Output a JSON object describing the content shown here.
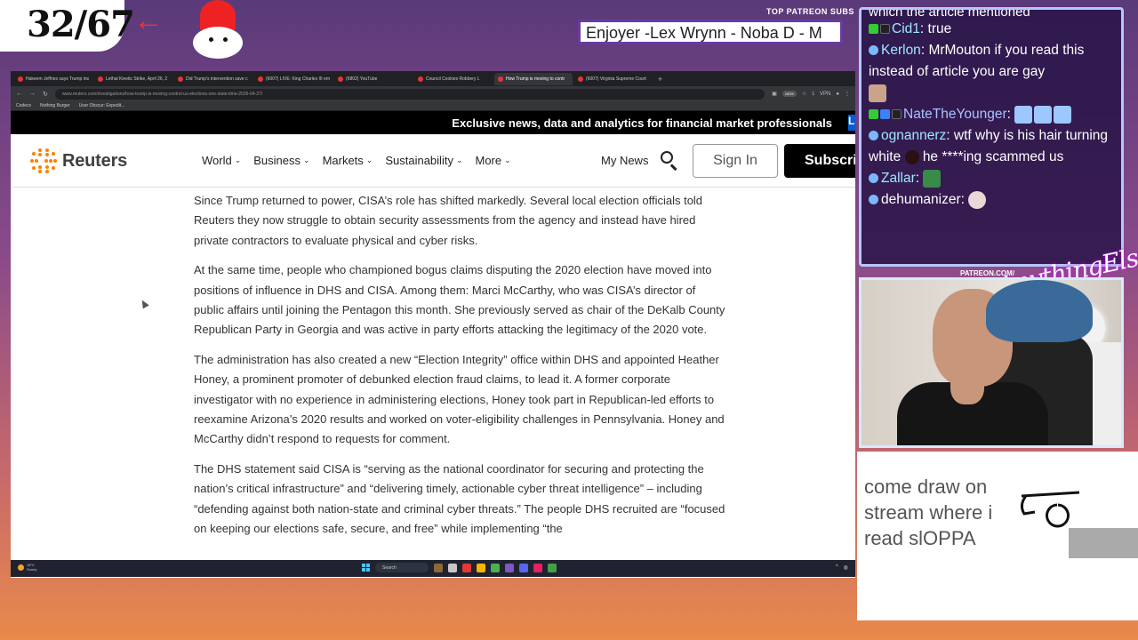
{
  "overlay": {
    "counter": "32/67",
    "patreon_label": "TOP PATREON SUBS",
    "ticker": "Enjoyer -Lex Wrynn -  Noba D - M",
    "patreon_small": "PATREON.COM/",
    "signature": "AnythingElse",
    "draw_text": "come draw on stream where i read slOPPA"
  },
  "browser": {
    "tabs": [
      {
        "label": "Hakeem Jeffries says Trump ins",
        "active": false
      },
      {
        "label": "Lethal Kinetic Strike, April 26, 2",
        "active": false
      },
      {
        "label": "Did Trump's intervention save c",
        "active": false
      },
      {
        "label": "(6007) LIVE: King Charles III em",
        "active": false
      },
      {
        "label": "(6802) YouTube",
        "active": false
      },
      {
        "label": "Council Cookies Robbery L",
        "active": false
      },
      {
        "label": "How Trump is moving to contr",
        "active": true
      },
      {
        "label": "(6007) Virginia Supreme Court",
        "active": false
      }
    ],
    "url": "www.reuters.com/investigations/how-trump-is-moving-control-us-elections-one-state-time-2026-04-27/",
    "zoom": "260%",
    "bookmarks": [
      "Codecs",
      "Nothing Burger",
      "User Obscur: Expedit..."
    ]
  },
  "reuters": {
    "promo": "Exclusive news, data and analytics for financial market professionals",
    "promo_button": "L",
    "logo": "Reuters",
    "nav": [
      "World",
      "Business",
      "Markets",
      "Sustainability",
      "More"
    ],
    "my_news": "My News",
    "sign_in": "Sign In",
    "subscribe": "Subscrib"
  },
  "article": {
    "paragraphs": [
      "Since Trump returned to power, CISA’s role has shifted markedly. Several local election officials told Reuters they now struggle to obtain security assessments from the agency and instead have hired private contractors to evaluate physical and cyber risks.",
      "At the same time, people who championed bogus claims disputing the 2020 election have moved into positions of influence in DHS and CISA. Among them: Marci McCarthy, who was CISA’s director of public affairs until joining the Pentagon this month. She previously served as chair of the DeKalb County Republican Party in Georgia and was active in party efforts attacking the legitimacy of the 2020 vote.",
      "The administration has also created a new “Election Integrity” office within DHS and appointed Heather Honey, a prominent promoter of debunked election fraud claims, to lead it. A former corporate investigator with no experience in administering elections, Honey took part in Republican-led efforts to reexamine Arizona’s 2020 results and worked on voter-eligibility challenges in Pennsylvania. Honey and McCarthy didn’t respond to requests for comment.",
      "The DHS statement said CISA is “serving as the national coordinator for securing and protecting the nation’s critical infrastructure” and “delivering timely, actionable cyber threat intelligence” – including “defending against both nation-state and criminal cyber threats.” The people DHS recruited are “focused on keeping our elections safe, secure, and free” while implementing “the"
    ]
  },
  "taskbar": {
    "weather_temp": "18°C",
    "weather_desc": "Sunny",
    "search": "Search"
  },
  "chat": {
    "top_partial": "which the article mentioned",
    "messages": [
      {
        "user": "Cid1",
        "text": "true",
        "color": "#7fd3ff"
      },
      {
        "user": "Kerlon",
        "text": "MrMouton if you read this instead of article you are gay",
        "color": "#7fd3ff"
      },
      {
        "user": "NateTheYounger",
        "text": "",
        "color": "#a7c2ff"
      },
      {
        "user": "ognannerz",
        "text": "wtf why is his hair turning white",
        "text2": "he ****ing scammed us",
        "color": "#7fd3ff"
      },
      {
        "user": "Zallar",
        "text": "",
        "color": "#7fd3ff"
      },
      {
        "user": "dehumanizer",
        "text": "",
        "color": "#ffffff"
      }
    ]
  }
}
